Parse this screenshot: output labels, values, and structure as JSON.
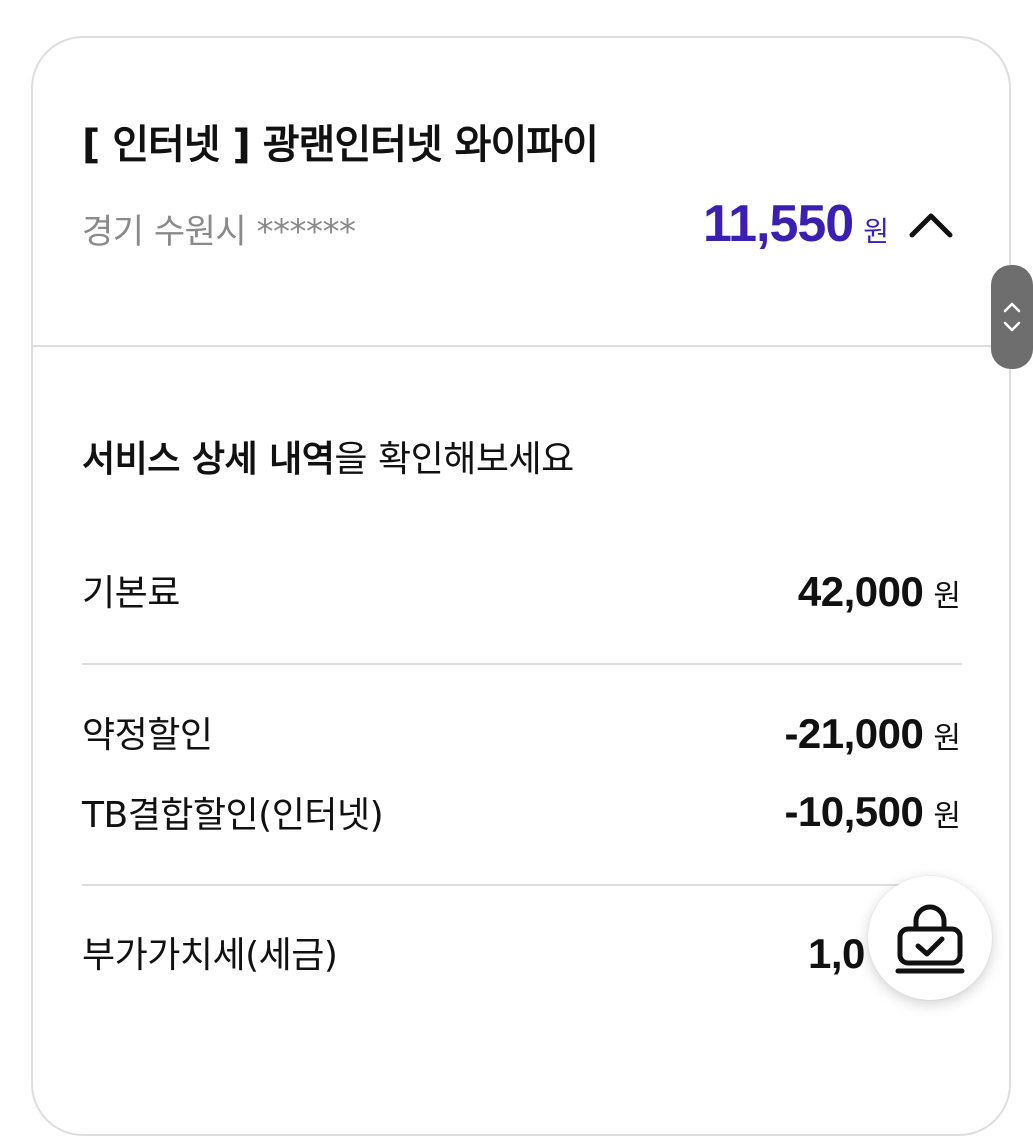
{
  "header": {
    "title": "[ 인터넷 ] 광랜인터넷 와이파이",
    "location": "경기 수원시 ******",
    "price": "11,550",
    "price_unit": "원",
    "toggle_icon": "chevron-up-icon"
  },
  "details": {
    "heading_bold": "서비스 상세 내역",
    "heading_rest": "을 확인해보세요",
    "items": [
      {
        "label": "기본료",
        "value": "42,000",
        "unit": "원"
      },
      {
        "label": "약정할인",
        "value": "-21,000",
        "unit": "원"
      },
      {
        "label": "TB결합할인(인터넷)",
        "value": "-10,500",
        "unit": "원"
      },
      {
        "label": "부가가치세(세금)",
        "value": "1,0",
        "unit": ""
      }
    ]
  },
  "scroll_handle": {
    "up_icon": "chevron-up-icon",
    "down_icon": "chevron-down-icon"
  },
  "fab": {
    "icon": "shopping-bag-check-icon"
  },
  "colors": {
    "accent": "#3b1fb3",
    "divider": "#dedede",
    "muted_text": "#8a8a8a"
  }
}
